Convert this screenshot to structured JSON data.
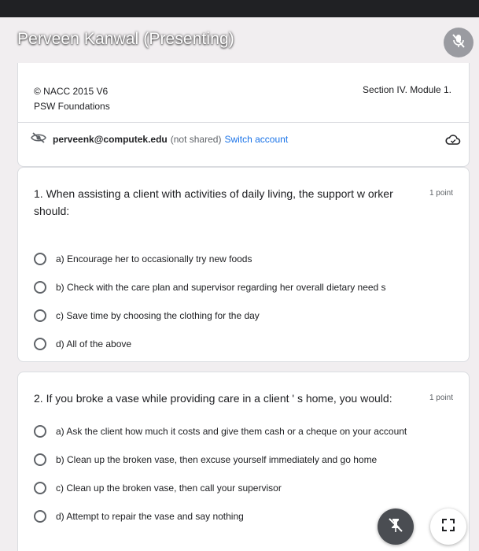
{
  "presenter": {
    "label": "Perveen Kanwal (Presenting)"
  },
  "form_header": {
    "copyright": "© NACC 2015 V6",
    "course": "PSW Foundations",
    "section": "Section IV. Module 1."
  },
  "account": {
    "email": "perveenk@computek.edu",
    "not_shared": "(not shared)",
    "switch": "Switch account"
  },
  "questions": [
    {
      "text": "1.  When assisting a client with activities of daily living, the support w orker should:",
      "points": "1 point",
      "options": [
        "a) Encourage her to occasionally try new foods",
        "b) Check with the care plan and supervisor regarding her overall dietary need s",
        "c) Save time by choosing the clothing for the day",
        "d) All of the above"
      ]
    },
    {
      "text": "2.  If you broke a vase while providing care in a client ' s home, you would:",
      "points": "1 point",
      "options": [
        "a) Ask the client how much it costs and give them cash or a cheque on your account",
        "b) Clean up the broken vase, then excuse yourself immediately and go home",
        "c) Clean up the broken vase, then call your supervisor",
        "d) Attempt to repair the vase and say nothing"
      ]
    }
  ],
  "icons": {
    "mic": "mic-off-icon",
    "account": "eye-off-icon",
    "cloud": "cloud-sync-icon",
    "pin": "unpin-icon",
    "fullscreen": "fullscreen-icon"
  }
}
